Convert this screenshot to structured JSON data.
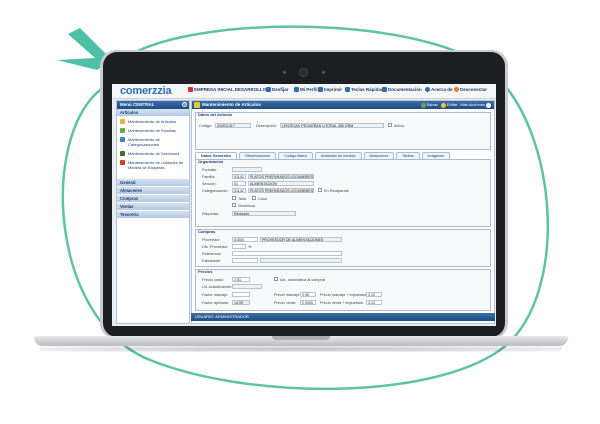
{
  "app": {
    "logo": "comerzzia",
    "toolbar": [
      {
        "label": "EMPRESA INICIAL DESARROLLO",
        "icon": "building-icon",
        "color": "#c0392b"
      },
      {
        "label": "Desfijar",
        "icon": "pin-icon",
        "color": "#2f6db3"
      },
      {
        "label": "Mi Perfil",
        "icon": "user-icon",
        "color": "#2f6db3"
      },
      {
        "label": "Imprimir",
        "icon": "printer-icon",
        "color": "#2f6db3"
      },
      {
        "label": "Teclas Rápidas",
        "icon": "keyboard-icon",
        "color": "#2f6db3"
      },
      {
        "label": "Documentación",
        "icon": "book-icon",
        "color": "#2f6db3"
      },
      {
        "label": "Acerca de",
        "icon": "info-icon",
        "color": "#2f6db3"
      },
      {
        "label": "Desconectar",
        "icon": "power-icon",
        "color": "#e67e22"
      }
    ]
  },
  "sidebar": {
    "title": "Menú CENTRAL",
    "section": "Artículos",
    "items": [
      {
        "label": "Mantenimiento de Artículos",
        "color": "#e8b33b"
      },
      {
        "label": "Mantenimiento de Familias",
        "color": "#6aa84f"
      },
      {
        "label": "Mantenimiento de Categorizaciones",
        "color": "#3d85c6"
      },
      {
        "label": "Mantenimiento de Secciones",
        "color": "#38761d"
      },
      {
        "label": "Mantenimiento de Unidades de Medida de Etiquetas",
        "color": "#cc4125"
      }
    ],
    "groups": [
      "General",
      "Almacenes",
      "Compras",
      "Ventas",
      "Tesorería"
    ]
  },
  "main": {
    "title": "Mantenimiento de Artículos",
    "buttons": [
      "Salvar",
      "Editar",
      "Más Acciones"
    ],
    "datos": {
      "title": "Datos del Artículo",
      "codigo_label": "Código:",
      "codigo": "010011017",
      "descripcion_label": "Descripción:",
      "descripcion": "LENTEJAS PEQUEÑAS LITORAL 380 GRM",
      "activo_label": "Activo"
    },
    "tabs": [
      "Datos Generales",
      "Observaciones",
      "Código Barra",
      "Unidades de medida",
      "Almacenes",
      "Tarifas",
      "Imágenes"
    ],
    "organizacion": {
      "title": "Organización",
      "formato_label": "Formato:",
      "familia_label": "Familia:",
      "familia_code": "01142",
      "familia": "PLATOS PREPARADOS LEGUMBRES",
      "seccion_label": "Sección:",
      "seccion_code": "01",
      "seccion": "ALIMENTACION",
      "categorizacion_label": "Categorización:",
      "categorizacion_code": "01142",
      "categorizacion": "PLATOS PREPARADOS LEGUMBRES",
      "escaparate_label": "En Escaparate",
      "talla_label": "Talla",
      "color_label": "Color",
      "genericos_label": "Genéricos",
      "etiquetas_label": "Etiquetas:",
      "etiquetas": "Reducido"
    },
    "compras": {
      "title": "Compras",
      "proveedor_label": "Proveedor:",
      "proveedor_code": "01000",
      "proveedor": "PROVEEDOR DE ALIMENTACIONES",
      "dto_label": "Dto. Proveedor:",
      "dto_unit": "%",
      "referencia_label": "Referencia:",
      "fabricante_label": "Fabricante:"
    },
    "precios": {
      "title": "Precios",
      "precio_costo_label": "Precio costo:",
      "precio_costo": "2,51",
      "act_label": "Act. automática al comprar",
      "ult_act_label": "Ult. Actualización:",
      "factor_marcaje_label": "Factor marcaje:",
      "precio_marcaje_label": "Precio marcaje:",
      "precio_marcaje": "2,95",
      "precio_marcaje_imp_label": "Precio marcaje + impuestos:",
      "precio_marcaje_imp": "3,10",
      "factor_aplicado_label": "Factor aplicado:",
      "factor_aplicado": "14,99",
      "precio_venta_label": "Precio venta:",
      "precio_venta": "2,9490",
      "precio_venta_imp_label": "Precio venta + impuestos:",
      "precio_venta_imp": "3,10"
    }
  },
  "footer": {
    "user": "USUARIO: ADMINISTRADOR"
  }
}
